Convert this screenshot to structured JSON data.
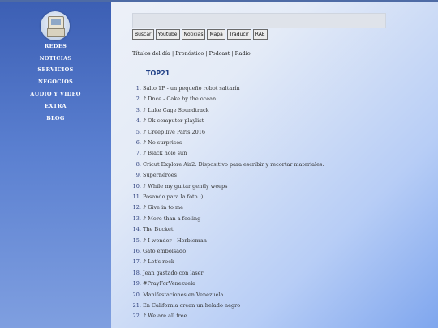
{
  "sidebar": {
    "items": [
      "REDES",
      "NOTICIAS",
      "SERVICIOS",
      "NEGOCIOS",
      "AUDIO Y VIDEO",
      "EXTRA",
      "BLOG"
    ]
  },
  "toolbar": {
    "buttons": [
      "Buscar",
      "Youtube",
      "Noticias",
      "Mapa",
      "Traducir",
      "RAE"
    ]
  },
  "links": [
    "Títulos del día",
    "Pronóstico",
    "Podcast",
    "Radio"
  ],
  "section_title": "TOP21",
  "list": [
    {
      "n": "1.",
      "t": "Salto 1P - un pequeño robot saltarín"
    },
    {
      "n": "2.",
      "t": "♪ Dnce - Cake by the ocean"
    },
    {
      "n": "3.",
      "t": "♪ Luke Cage Soundtrack"
    },
    {
      "n": "4.",
      "t": "♪ Ok computer playlist"
    },
    {
      "n": "5.",
      "t": "♪ Creep live Paris 2016"
    },
    {
      "n": "6.",
      "t": "♪ No surprises"
    },
    {
      "n": "7.",
      "t": "♪ Black hole sun"
    },
    {
      "n": "8.",
      "t": "Cricut Explore Air2: Dispositivo para escribir y recortar materiales."
    },
    {
      "n": "9.",
      "t": "Superhéroes"
    },
    {
      "n": "10.",
      "t": "♪ While my guitar gently weeps"
    },
    {
      "n": "11.",
      "t": "Posando para la foto :)"
    },
    {
      "n": "12.",
      "t": "♪ Give in to me"
    },
    {
      "n": "13.",
      "t": "♪ More than a feeling"
    },
    {
      "n": "14.",
      "t": "The Bucket"
    },
    {
      "n": "15.",
      "t": "♪ I wonder - Herbieman"
    },
    {
      "n": "16.",
      "t": "Gato embolsado"
    },
    {
      "n": "17.",
      "t": "♪ Let's rock"
    },
    {
      "n": "18.",
      "t": "Jean gastado con laser"
    },
    {
      "n": "19.",
      "t": "#PrayForVenezuela"
    },
    {
      "n": "20.",
      "t": "Manifestaciones en Venezuela"
    },
    {
      "n": "21.",
      "t": "En California crean un helado negro"
    },
    {
      "n": "22.",
      "t": "♪ We are all free"
    }
  ]
}
